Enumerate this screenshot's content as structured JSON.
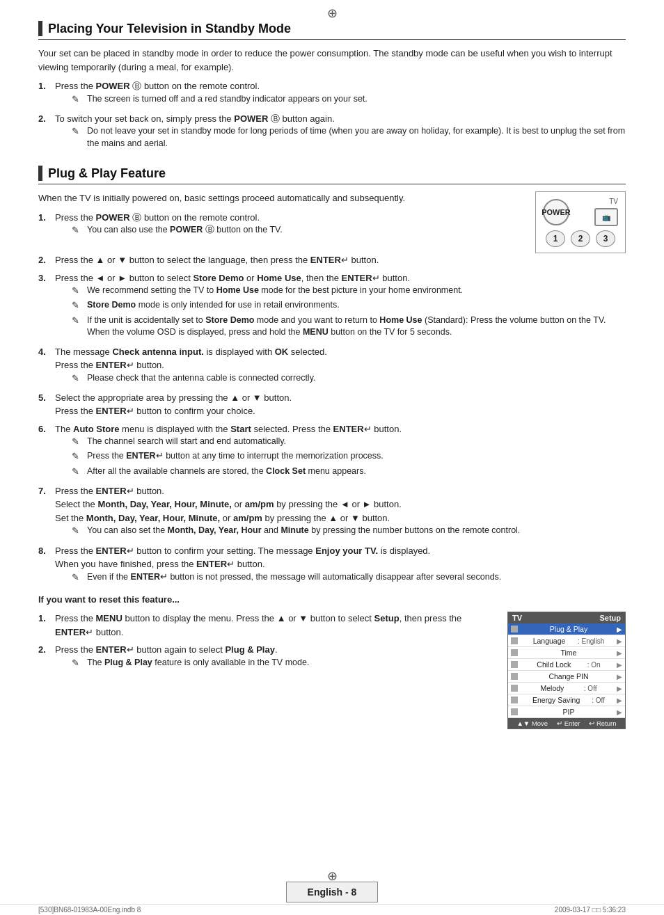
{
  "page": {
    "top_crosshair": "⊕",
    "bottom_crosshair": "⊕"
  },
  "section1": {
    "title": "Placing Your Television in Standby Mode",
    "intro": "Your set can be placed in standby mode in order to reduce the power consumption. The standby mode can be useful when you wish to interrupt viewing temporarily (during a meal, for example).",
    "items": [
      {
        "num": "1.",
        "text": "Press the POWER button on the remote control.",
        "notes": [
          "The screen is turned off and a red standby indicator appears on your set."
        ]
      },
      {
        "num": "2.",
        "text": "To switch your set back on, simply press the POWER button again.",
        "notes": [
          "Do not leave your set in standby mode for long periods of time (when you are away on holiday, for example). It is best to unplug the set from the mains and aerial."
        ]
      }
    ]
  },
  "section2": {
    "title": "Plug & Play Feature",
    "intro": "When the TV is initially powered on, basic settings proceed automatically and subsequently.",
    "items": [
      {
        "num": "1.",
        "text": "Press the POWER button on the remote control.",
        "notes": [
          "You can also use the POWER button on the TV."
        ]
      },
      {
        "num": "2.",
        "text": "Press the ▲ or ▼ button to select the language, then press the ENTER button.",
        "notes": []
      },
      {
        "num": "3.",
        "text": "Press the ◄ or ► button to select Store Demo or Home Use, then the ENTER button.",
        "notes": [
          "We recommend setting the TV to Home Use mode for the best picture in your home environment.",
          "Store Demo mode is only intended for use in retail environments.",
          "If the unit is accidentally set to Store Demo mode and you want to return to Home Use (Standard): Press the volume button on the TV. When the volume OSD is displayed, press and hold the MENU button on the TV for 5 seconds."
        ]
      },
      {
        "num": "4.",
        "text": "The message Check antenna input. is displayed with OK selected.\nPress the ENTER button.",
        "notes": [
          "Please check that the antenna cable is connected correctly."
        ]
      },
      {
        "num": "5.",
        "text": "Select the appropriate area by pressing the ▲ or ▼ button.\nPress the ENTER button to confirm your choice.",
        "notes": []
      },
      {
        "num": "6.",
        "text": "The Auto Store menu is displayed with the Start selected. Press the ENTER button.",
        "notes": [
          "The channel search will start and end automatically.",
          "Press the ENTER button at any time to interrupt the memorization process.",
          "After all the available channels are stored, the Clock Set menu appears."
        ]
      },
      {
        "num": "7.",
        "text": "Press the ENTER button.\nSelect the Month, Day, Year, Hour, Minute, or am/pm by pressing the ◄ or ► button.\nSet the Month, Day, Year, Hour, Minute, or am/pm by pressing the ▲ or ▼ button.",
        "notes": [
          "You can also set the Month, Day, Year, Hour and Minute by pressing the number buttons on the remote control."
        ]
      },
      {
        "num": "8.",
        "text": "Press the ENTER button to confirm your setting. The message Enjoy your TV. is displayed.\nWhen you have finished, press the ENTER button.",
        "notes": [
          "Even if the ENTER button is not pressed, the message will automatically disappear after several seconds."
        ]
      }
    ],
    "reset_section": {
      "title": "If you want to reset this feature...",
      "items": [
        {
          "num": "1.",
          "text": "Press the MENU button to display the menu. Press the ▲ or ▼ button to select Setup, then press the ENTER button.",
          "notes": []
        },
        {
          "num": "2.",
          "text": "Press the ENTER button again to select Plug & Play.",
          "notes": [
            "The Plug & Play feature is only available in the TV mode."
          ]
        }
      ]
    }
  },
  "remote": {
    "power_label": "POWER",
    "tv_label": "TV",
    "btn1": "1",
    "btn2": "2",
    "btn3": "3"
  },
  "setup_menu": {
    "header_left": "TV",
    "header_right": "Setup",
    "rows": [
      {
        "icon": true,
        "label": "Plug & Play",
        "value": "",
        "highlighted": true
      },
      {
        "icon": true,
        "label": "Language",
        "value": ": English",
        "highlighted": false
      },
      {
        "icon": true,
        "label": "Time",
        "value": "",
        "highlighted": false
      },
      {
        "icon": true,
        "label": "Child Lock",
        "value": ": On",
        "highlighted": false
      },
      {
        "icon": true,
        "label": "Change PIN",
        "value": "",
        "highlighted": false
      },
      {
        "icon": true,
        "label": "Melody",
        "value": ": Off",
        "highlighted": false
      },
      {
        "icon": true,
        "label": "Energy Saving",
        "value": ": Off",
        "highlighted": false
      },
      {
        "icon": true,
        "label": "PIP",
        "value": "",
        "highlighted": false
      }
    ],
    "footer": "▲▼ Move   ↵ Enter   ↩ Return"
  },
  "footer": {
    "page_label": "English - 8",
    "left_info": "[530]BN68-01983A-00Eng.indb   8",
    "right_info": "2009-03-17   □□ 5:36:23"
  }
}
